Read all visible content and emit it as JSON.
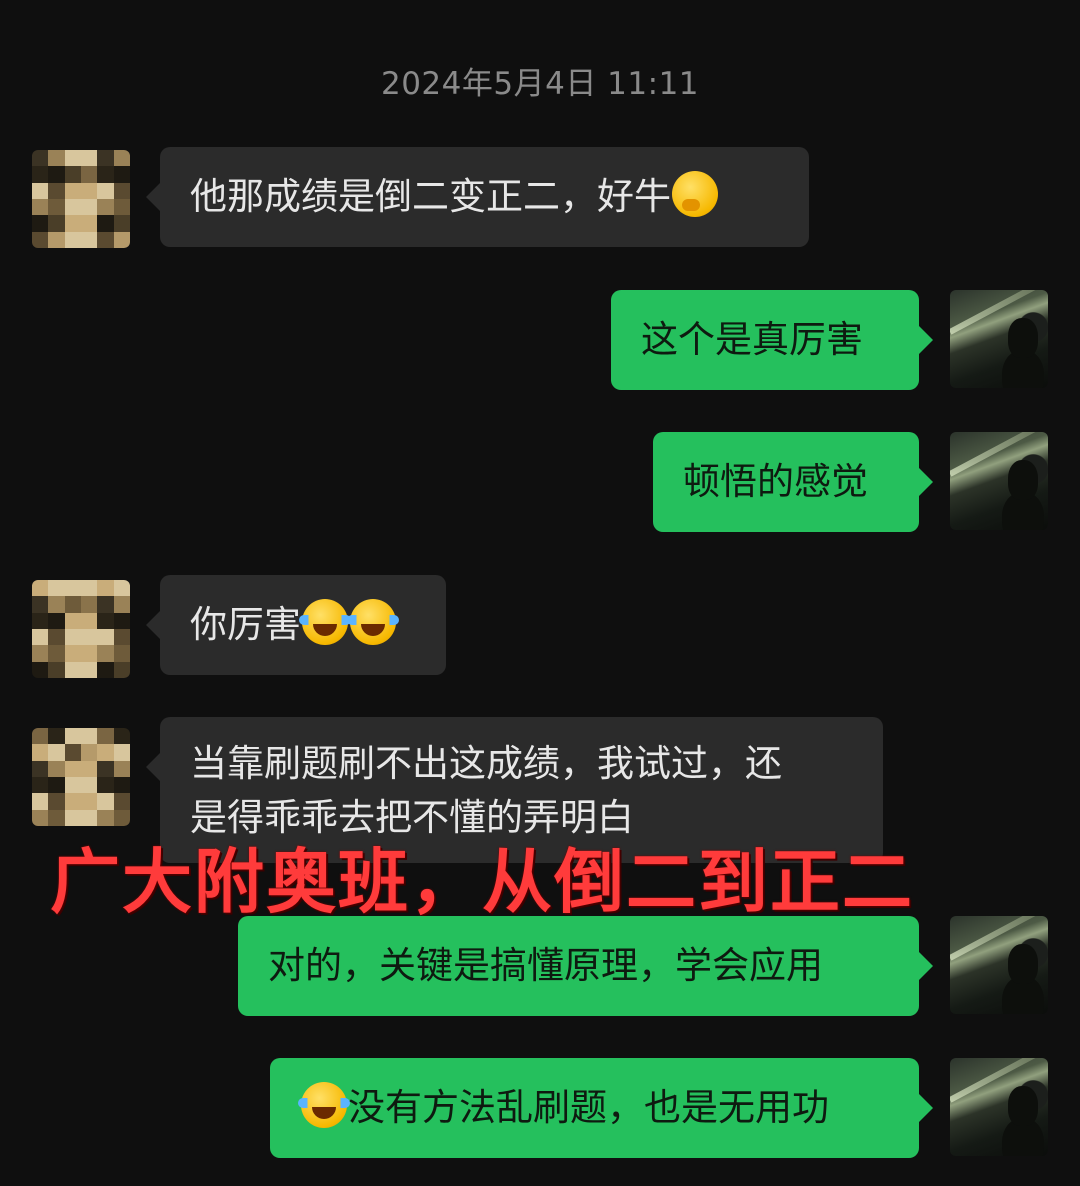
{
  "timestamp": "2024年5月4日 11:11",
  "messages": [
    {
      "side": "left",
      "text": "他那成绩是倒二变正二，好牛",
      "emojis": [
        "thinking-face"
      ]
    },
    {
      "side": "right",
      "text": "这个是真厉害"
    },
    {
      "side": "right",
      "text": "顿悟的感觉"
    },
    {
      "side": "left",
      "text": "你厉害",
      "emojis": [
        "tears-of-joy",
        "tears-of-joy"
      ]
    },
    {
      "side": "left",
      "text_line1": "当靠刷题刷不出这成绩，我试过，还",
      "text_line2": "是得乖乖去把不懂的弄明白"
    },
    {
      "side": "right",
      "text": "对的，关键是搞懂原理，学会应用"
    },
    {
      "side": "right",
      "text": "没有方法乱刷题，也是无用功",
      "emojis": [
        "tears-of-joy"
      ]
    }
  ],
  "overlay_caption": "广大附奥班，从倒二到正二",
  "colors": {
    "background": "#0f0f0f",
    "incoming_bubble": "#2b2b2b",
    "outgoing_bubble": "#25c05d",
    "caption": "#ff3b3b",
    "timestamp": "#8a8a8a"
  }
}
